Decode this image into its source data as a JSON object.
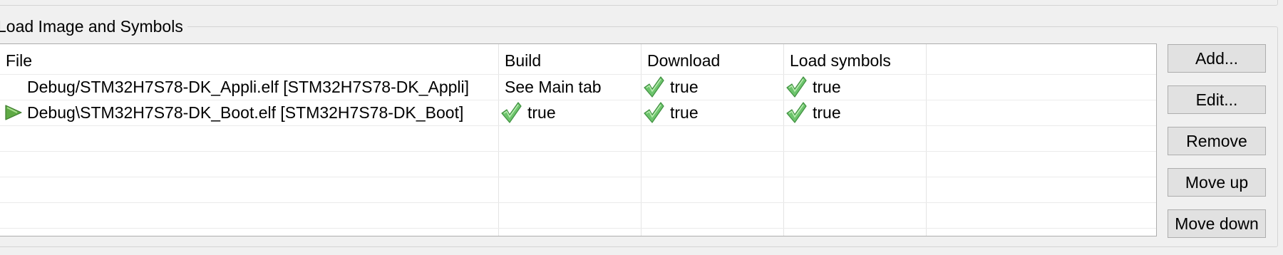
{
  "group_title": "Load Image and Symbols",
  "table": {
    "columns": [
      "File",
      "Build",
      "Download",
      "Load symbols"
    ],
    "rows": [
      {
        "file": "Debug/STM32H7S78-DK_Appli.elf [STM32H7S78-DK_Appli]",
        "build": "See Main tab",
        "download": "true",
        "load_symbols": "true",
        "selected_marker": false
      },
      {
        "file": "Debug\\STM32H7S78-DK_Boot.elf [STM32H7S78-DK_Boot]",
        "build": "true",
        "download": "true",
        "load_symbols": "true",
        "selected_marker": true
      }
    ]
  },
  "buttons": {
    "add": "Add...",
    "edit": "Edit...",
    "remove": "Remove",
    "move_up": "Move up",
    "move_down": "Move down"
  },
  "icons": {
    "check": "green-checkmark-icon",
    "marker": "green-play-arrow-icon"
  },
  "colors": {
    "background": "#f0f0f0",
    "table_background": "#ffffff",
    "check_green": "#5cb85c",
    "button_face": "#e1e1e1"
  }
}
